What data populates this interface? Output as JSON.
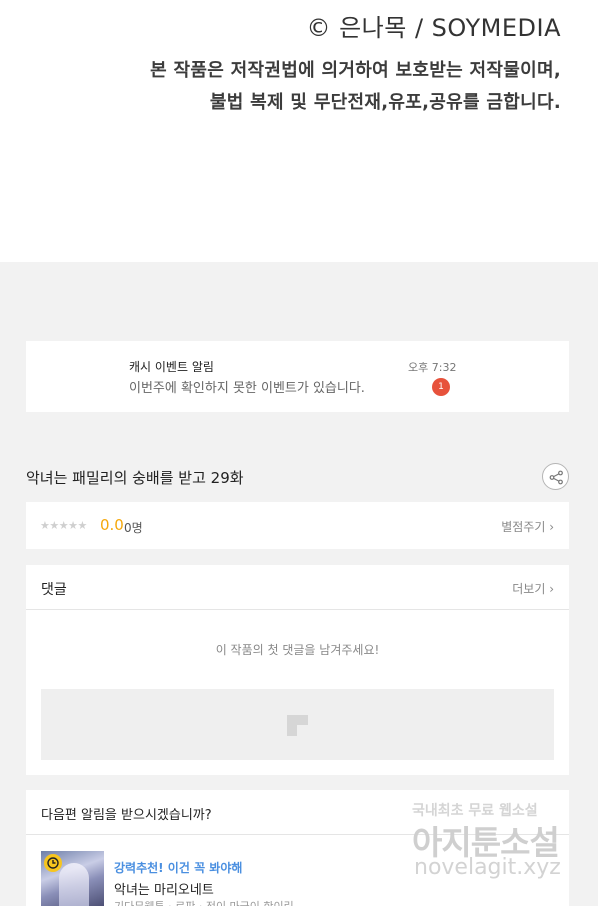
{
  "copyright": {
    "title": "© 은나목 / SOYMEDIA",
    "line1": "본 작품은 저작권법에 의거하여 보호받는 저작물이며,",
    "line2": "불법 복제 및 무단전재,유포,공유를 금합니다."
  },
  "notice": {
    "title": "캐시 이벤트 알림",
    "text": "이번주에 확인하지 못한 이벤트가 있습니다.",
    "time": "오후 7:32",
    "badge": "1"
  },
  "episode": {
    "title": "악녀는 패밀리의 숭배를 받고 29화",
    "share_icon": "share-icon"
  },
  "rating": {
    "stars": "★★★★★",
    "score": "0.0",
    "count": "0명",
    "rate_link": "별점주기 ›",
    "star_color": "#cfcfcf",
    "score_color": "#f5a80c"
  },
  "comments": {
    "title": "댓글",
    "more_link": "더보기 ›",
    "empty_message": "이 작품의 첫 댓글을 남겨주세요!"
  },
  "next_alert": {
    "title": "다음편 알림을 받으시겠습니까?",
    "recommendation": {
      "tag": "강력추천! 이건 꼭 봐야해",
      "title": "악녀는 마리오네트",
      "subtitle": "기다무웹툰 · 로판 · 전이 마금이 한이린",
      "tag_color": "#4a8fe0"
    }
  },
  "watermark": {
    "small": "국내최초 무료 웹소설",
    "big": "아지툰소설",
    "url": "novelagit.xyz"
  }
}
